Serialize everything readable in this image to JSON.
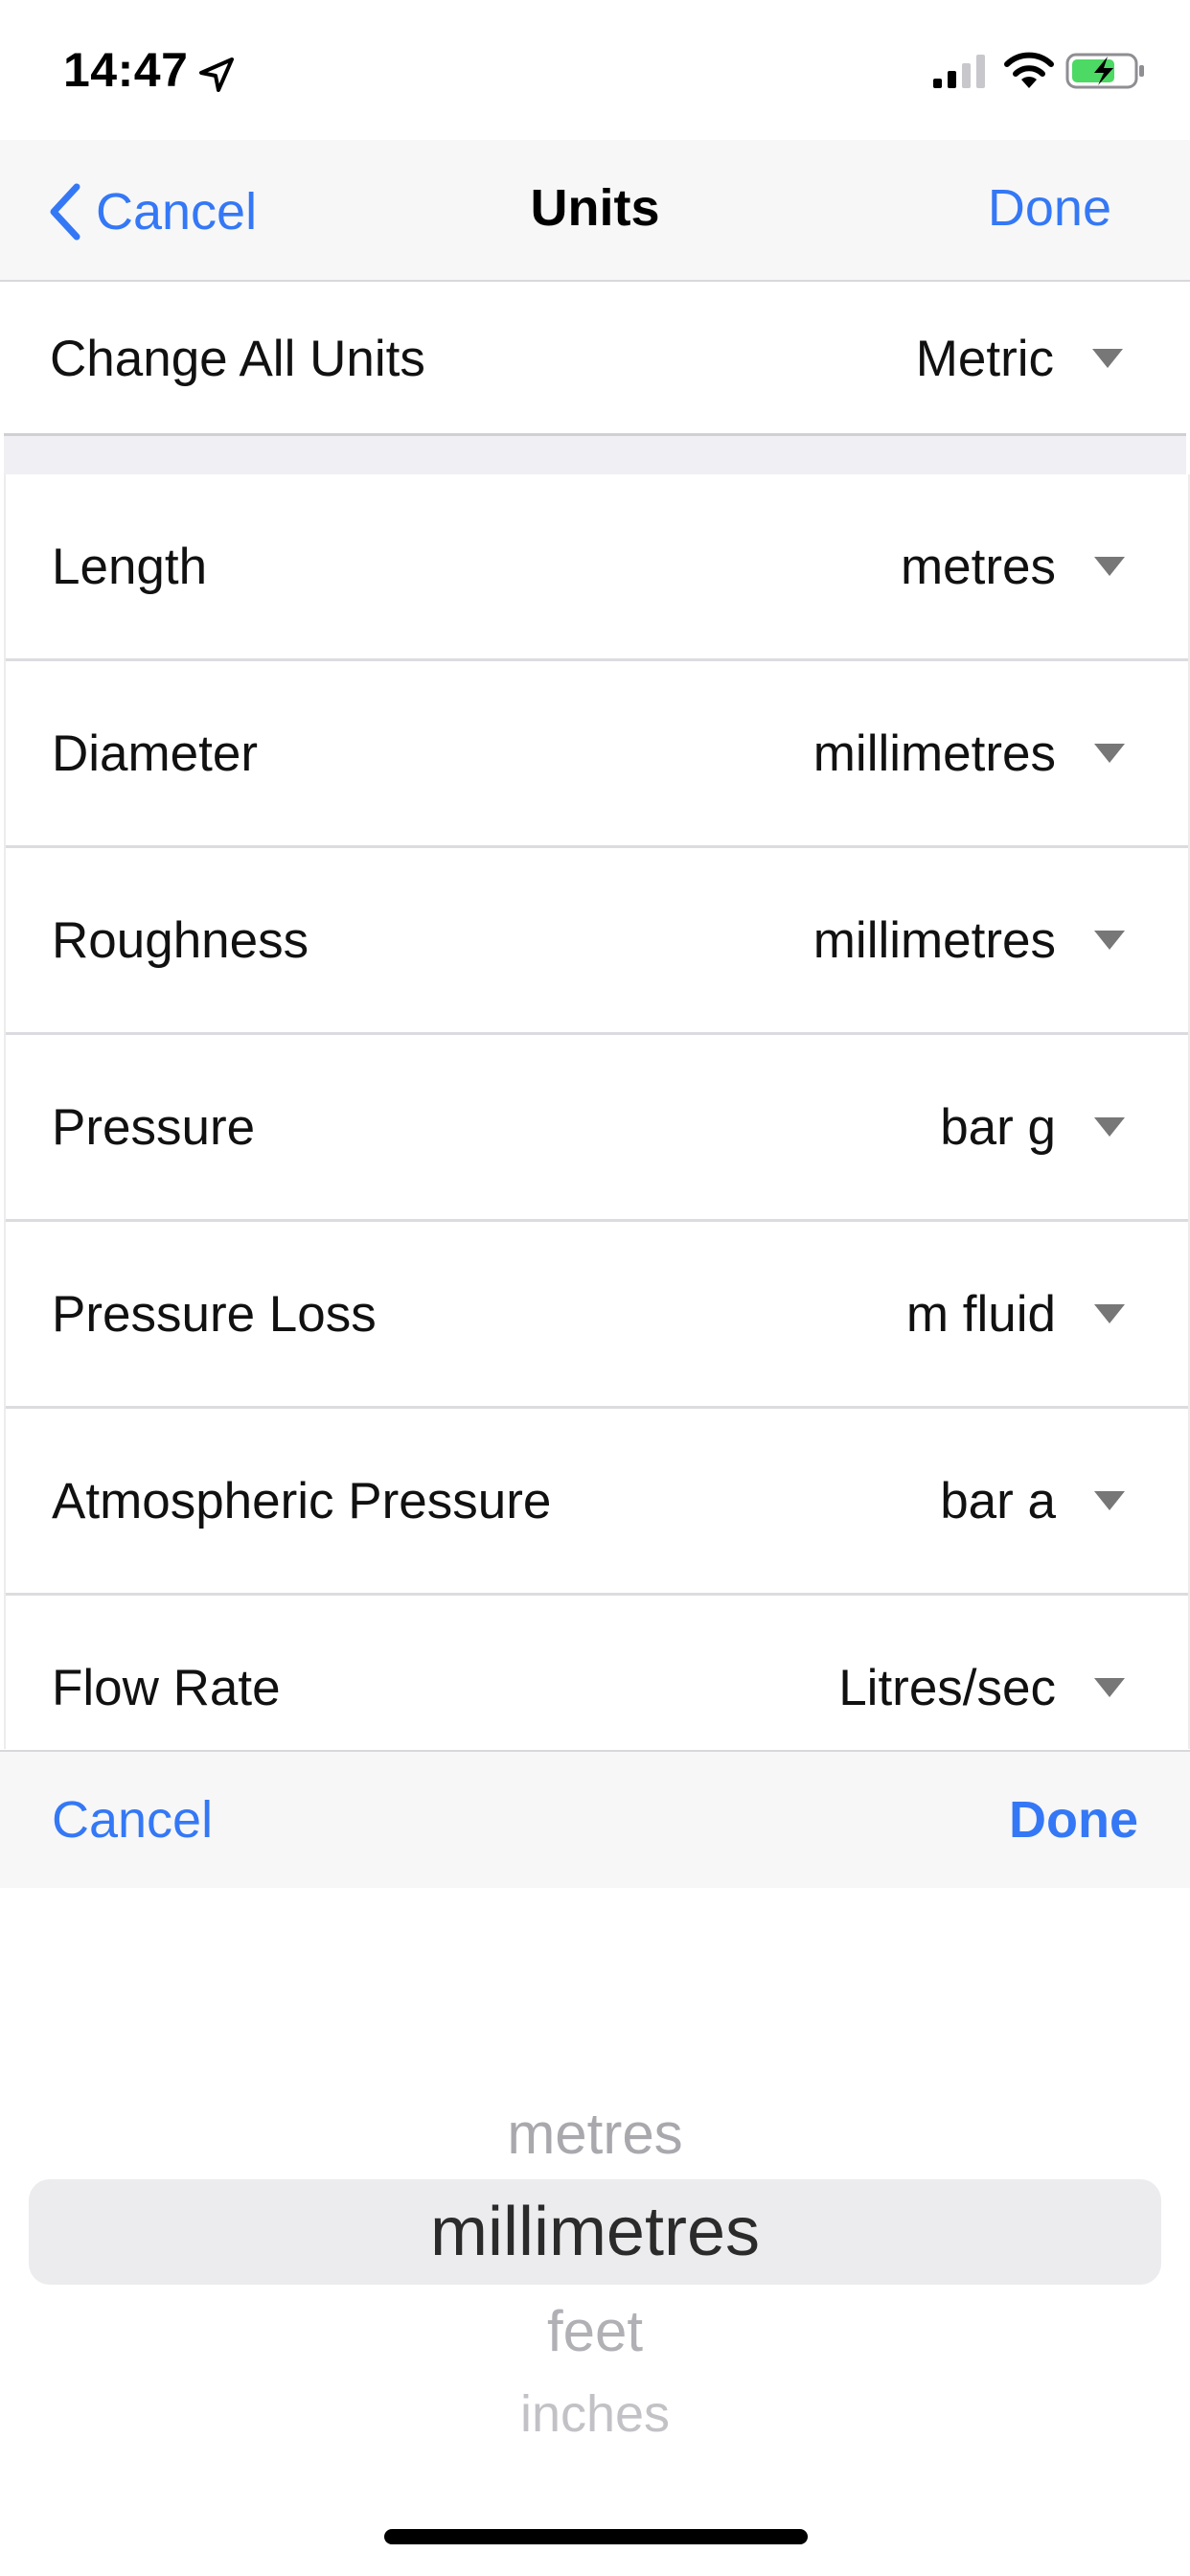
{
  "status_bar": {
    "time": "14:47"
  },
  "nav": {
    "back_label": "Cancel",
    "title": "Units",
    "done_label": "Done"
  },
  "change_all": {
    "label": "Change All Units",
    "value": "Metric"
  },
  "rows": [
    {
      "label": "Length",
      "value": "metres"
    },
    {
      "label": "Diameter",
      "value": "millimetres"
    },
    {
      "label": "Roughness",
      "value": "millimetres"
    },
    {
      "label": "Pressure",
      "value": "bar g"
    },
    {
      "label": "Pressure Loss",
      "value": "m fluid"
    },
    {
      "label": "Atmospheric Pressure",
      "value": "bar a"
    },
    {
      "label": "Flow Rate",
      "value": "Litres/sec"
    }
  ],
  "picker_toolbar": {
    "cancel_label": "Cancel",
    "done_label": "Done"
  },
  "picker": {
    "options": [
      "metres",
      "millimetres",
      "feet",
      "inches"
    ],
    "selected": "millimetres"
  },
  "colors": {
    "accent": "#3478f6",
    "toolbar_bg": "#f7f7f7",
    "separator": "#dcdce0"
  }
}
